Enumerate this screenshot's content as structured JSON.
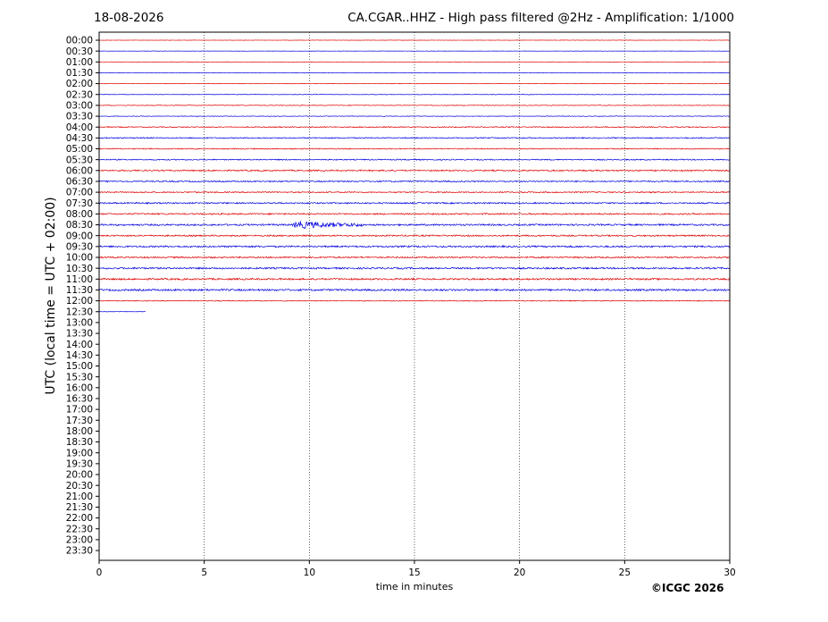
{
  "header": {
    "date": "18-08-2026",
    "title": "CA.CGAR..HHZ - High pass filtered @2Hz - Amplification: 1/1000"
  },
  "footer": {
    "copyright": "©ICGC 2026"
  },
  "chart_data": {
    "type": "line",
    "title": "CA.CGAR..HHZ - High pass filtered @2Hz - Amplification: 1/1000",
    "xlabel": "time in minutes",
    "ylabel": "UTC (local time = UTC + 02:00)",
    "xlim": [
      0,
      30
    ],
    "xticks": [
      0,
      5,
      10,
      15,
      20,
      25,
      30
    ],
    "x_grid": "vertical dotted lines at 5, 10, 15, 20, 25",
    "rows": [
      "00:00",
      "00:30",
      "01:00",
      "01:30",
      "02:00",
      "02:30",
      "03:00",
      "03:30",
      "04:00",
      "04:30",
      "05:00",
      "05:30",
      "06:00",
      "06:30",
      "07:00",
      "07:30",
      "08:00",
      "08:30",
      "09:00",
      "09:30",
      "10:00",
      "10:30",
      "11:00",
      "11:30",
      "12:00",
      "12:30",
      "13:00",
      "13:30",
      "14:00",
      "14:30",
      "15:00",
      "15:30",
      "16:00",
      "16:30",
      "17:00",
      "17:30",
      "18:00",
      "18:30",
      "19:00",
      "19:30",
      "20:00",
      "20:30",
      "21:00",
      "21:30",
      "22:00",
      "22:30",
      "23:00",
      "23:30"
    ],
    "colors": {
      "even_rows": "#e00000",
      "odd_rows": "#0000e0"
    },
    "trace_end": {
      "row": "12:30",
      "minutes": 2.2
    },
    "noise_level": [
      0.15,
      0.15,
      0.2,
      0.2,
      0.25,
      0.25,
      0.35,
      0.3,
      0.55,
      0.6,
      0.55,
      0.6,
      0.75,
      0.7,
      0.65,
      0.75,
      0.8,
      0.9,
      0.8,
      0.9,
      0.8,
      0.9,
      0.9,
      1.0,
      0.5,
      0.3
    ],
    "events": [
      {
        "row": "03:00",
        "start": 4.2,
        "end": 4.6,
        "amplitude": 0.5
      },
      {
        "row": "04:00",
        "start": 13.0,
        "end": 13.4,
        "amplitude": 0.9
      },
      {
        "row": "08:30",
        "start": 9.2,
        "end": 12.5,
        "amplitude": 4.5
      },
      {
        "row": "09:30",
        "start": 6.1,
        "end": 8.2,
        "amplitude": 1.2
      },
      {
        "row": "10:30",
        "start": 11.2,
        "end": 12.2,
        "amplitude": 1.0
      },
      {
        "row": "11:30",
        "start": 27.2,
        "end": 27.8,
        "amplitude": 0.8
      }
    ]
  }
}
